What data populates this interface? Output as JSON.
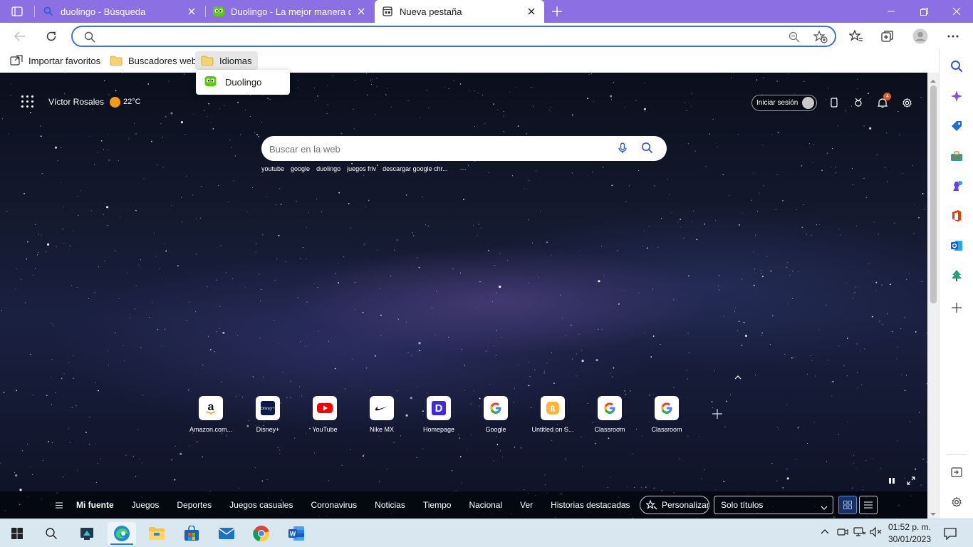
{
  "tabs": [
    {
      "title": "duolingo - Búsqueda",
      "icon": "search-icon"
    },
    {
      "title": "Duolingo - La mejor manera de a",
      "icon": "duolingo-icon"
    },
    {
      "title": "Nueva pestaña",
      "icon": "newtab-icon"
    }
  ],
  "address": {
    "value": "",
    "placeholder": ""
  },
  "favorites": [
    {
      "label": "Importar favoritos",
      "icon": "import-icon"
    },
    {
      "label": "Buscadores web",
      "icon": "folder-icon"
    },
    {
      "label": "Idiomas",
      "icon": "folder-icon"
    }
  ],
  "favorites_menu": {
    "items": [
      {
        "label": "Duolingo"
      }
    ]
  },
  "ntp": {
    "user_name": "Víctor Rosales",
    "temperature": "22°C",
    "signin_label": "Iniciar sesión",
    "notification_count": "4",
    "search_placeholder": "Buscar en la web",
    "trending": [
      "youtube",
      "google",
      "duolingo",
      "juegos friv",
      "descargar google chr...",
      "···"
    ],
    "tiles": [
      {
        "label": "Amazon.com...",
        "icon": "amazon-icon"
      },
      {
        "label": "Disney+",
        "icon": "disney-icon"
      },
      {
        "label": "YouTube",
        "icon": "youtube-icon"
      },
      {
        "label": "Nike MX",
        "icon": "nike-icon"
      },
      {
        "label": "Homepage",
        "icon": "homepage-d-icon"
      },
      {
        "label": "Google",
        "icon": "google-icon"
      },
      {
        "label": "Untitled on S...",
        "icon": "untitled-icon"
      },
      {
        "label": "Classroom",
        "icon": "google-icon"
      },
      {
        "label": "Classroom",
        "icon": "google-icon"
      }
    ],
    "feed": {
      "items": [
        "Mi fuente",
        "Juegos",
        "Deportes",
        "Juegos casuales",
        "Coronavirus",
        "Noticias",
        "Tiempo",
        "Nacional",
        "Ver",
        "Historias destacadas"
      ],
      "more": "···",
      "personalize_label": "Personalizar",
      "layout_select": "Solo títulos"
    }
  },
  "clock": {
    "time": "01:52 p. m.",
    "date": "30/01/2023"
  },
  "colors": {
    "tabbar": "#8c6fe3",
    "accent": "#3b74d9",
    "taskbar": "#d8e7f0"
  }
}
